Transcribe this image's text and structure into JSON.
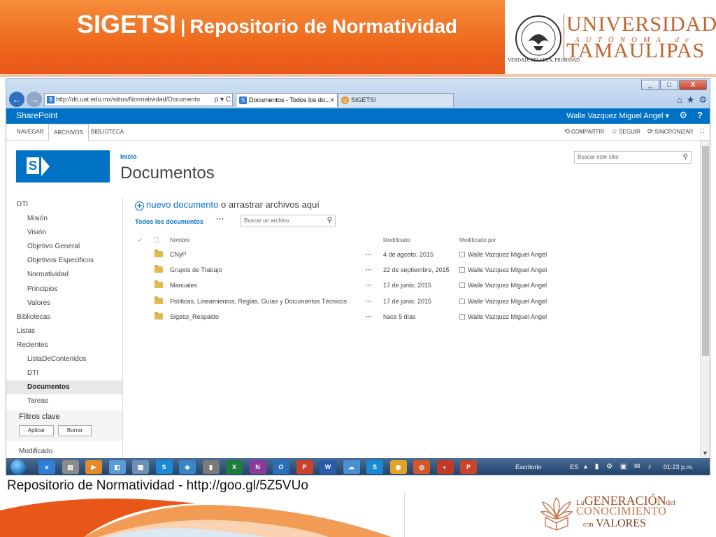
{
  "slide": {
    "title": "SIGETSI",
    "separator": "|",
    "subtitle": "Repositorio de Normatividad",
    "caption": "Repositorio de Normatividad - http://goo.gl/5Z5VUo",
    "uat_logo": {
      "line1": "UNIVERSIDAD",
      "line2": "AUTÓNOMA de",
      "line3": "TAMAULIPAS",
      "motto": "VERDAD, BELLEZA, PROBIDAD"
    },
    "generacion_logo": {
      "la": "La",
      "generacion": "GENERACIÓN",
      "del": "del",
      "conocimiento": "CONOCIMIENTO",
      "con": "con",
      "valores": "VALORES"
    },
    "colors": {
      "banner": "#ef6a1f",
      "uat": "#c2622e"
    }
  },
  "browser": {
    "url": "http://dti.uat.edu.mx/sitios/Normatividad/Documento",
    "url_tools": "ρ ▾ C",
    "tabs": [
      {
        "label": "Documentos - Todos los do..."
      },
      {
        "label": "SIGETSI"
      }
    ],
    "window_controls": [
      "_",
      "□",
      "X"
    ]
  },
  "suite_bar": {
    "brand": "SharePoint",
    "user": "Walle Vazquez Miguel Angel ▾",
    "color": "#0072c6"
  },
  "ribbon": {
    "tabs": [
      "NAVEGAR",
      "ARCHIVOS",
      "BIBLIOTECA"
    ],
    "actions": {
      "share": "COMPARTIR",
      "follow": "SEGUIR",
      "sync": "SINCRONIZAR"
    }
  },
  "site_search": {
    "placeholder": "Buscar este sitio"
  },
  "left_nav": {
    "items": [
      {
        "label": "DTI"
      },
      {
        "label": "Misión"
      },
      {
        "label": "Visión"
      },
      {
        "label": "Objetivo General"
      },
      {
        "label": "Objetivos Especificos"
      },
      {
        "label": "Normatividad"
      },
      {
        "label": "Principios"
      },
      {
        "label": "Valores"
      },
      {
        "label": "Bibliotecas"
      },
      {
        "label": "Listas"
      },
      {
        "label": "Recientes"
      },
      {
        "label": "ListaDeContenidos"
      },
      {
        "label": "DTI"
      },
      {
        "label": "Documentos"
      },
      {
        "label": "Tareas"
      }
    ],
    "filters_title": "Filtros clave",
    "apply_label": "Aplicar",
    "clear_label": "Borrar",
    "modified_label": "Modificado"
  },
  "main": {
    "breadcrumb": "Inicio",
    "page_title": "Documentos",
    "new_doc_link": "nuevo documento",
    "new_doc_suffix": "o arrastrar archivos aquí",
    "view_label": "Todos los documentos",
    "view_more": "···",
    "file_search_placeholder": "Buscar un archivo",
    "columns": {
      "check": "✓",
      "name": "Nombre",
      "modified": "Modificado",
      "modified_by": "Modificado por"
    },
    "rows": [
      {
        "name": "CNyP",
        "modified": "4 de agosto, 2015",
        "modified_by": "Walle Vazquez Miguel Angel"
      },
      {
        "name": "Grupos de Trabajo",
        "modified": "22 de septiembre, 2015",
        "modified_by": "Walle Vazquez Miguel Angel"
      },
      {
        "name": "Manuales",
        "modified": "17 de junio, 2015",
        "modified_by": "Walle Vazquez Miguel Angel"
      },
      {
        "name": "Políticas, Lineamientos, Reglas, Guías y Documentos Técnicos",
        "modified": "17 de junio, 2015",
        "modified_by": "Walle Vazquez Miguel Angel"
      },
      {
        "name": "Sigetsi_Respaldo",
        "modified": "hace 5 días",
        "modified_by": "Walle Vazquez Miguel Angel"
      }
    ],
    "row_menu": "···"
  },
  "taskbar": {
    "apps": [
      "e",
      "▤",
      "▶",
      "◧",
      "▦",
      "S",
      "◈",
      "▮",
      "X",
      "N",
      "O",
      "P",
      "W",
      "☁",
      "S",
      "◉",
      "◎",
      "◐",
      "P"
    ],
    "desktop_label": "Escritorio",
    "language": "ES",
    "clock": "01:23 p.m."
  }
}
